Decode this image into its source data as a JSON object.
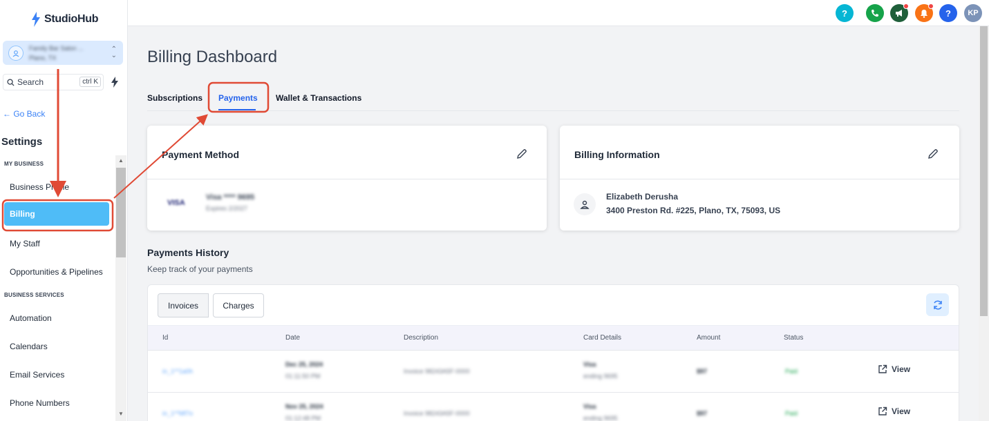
{
  "brand": {
    "name": "StudioHub"
  },
  "account": {
    "name": "Family Bar Salon ...",
    "sub": "Plano, TX"
  },
  "search": {
    "label": "Search",
    "shortcut": "ctrl K"
  },
  "sidebar": {
    "go_back": "← Go Back",
    "title": "Settings",
    "section_business": "MY BUSINESS",
    "section_services": "BUSINESS SERVICES",
    "items": [
      "Business Profile",
      "Billing",
      "My Staff",
      "Opportunities & Pipelines"
    ],
    "service_items": [
      "Automation",
      "Calendars",
      "Email Services",
      "Phone Numbers"
    ]
  },
  "header": {
    "icons": [
      {
        "name": "help-icon",
        "glyph": "?",
        "color": "#06b6d4"
      },
      {
        "name": "phone-icon",
        "glyph": "✆",
        "color": "#16a34a"
      },
      {
        "name": "megaphone-icon",
        "glyph": "📢",
        "color": "#166534"
      },
      {
        "name": "bell-icon",
        "glyph": "🔔",
        "color": "#f97316"
      },
      {
        "name": "help-circle-icon",
        "glyph": "?",
        "color": "#2563eb"
      }
    ],
    "avatar": "KP"
  },
  "page": {
    "title": "Billing Dashboard",
    "tabs": [
      "Subscriptions",
      "Payments",
      "Wallet & Transactions"
    ],
    "active_tab": "Payments"
  },
  "payment_method": {
    "title": "Payment Method",
    "brand": "VISA",
    "card": "Visa **** 9695",
    "expires": "Expires 2/2027"
  },
  "billing_info": {
    "title": "Billing Information",
    "name": "Elizabeth Derusha",
    "address": "3400 Preston Rd. #225, Plano, TX, 75093, US"
  },
  "history": {
    "title": "Payments History",
    "subtitle": "Keep track of your payments",
    "segments": [
      "Invoices",
      "Charges"
    ],
    "columns": [
      "Id",
      "Date",
      "Description",
      "Card Details",
      "Amount",
      "Status"
    ],
    "rows": [
      {
        "id": "in_1**1a0h",
        "date": "Dec 25, 2024",
        "time": "01:11:50 PM",
        "description": "Invoice 98243A5F-0000",
        "card": "Visa",
        "card_sub": "ending 9695",
        "amount": "$97",
        "status": "Paid",
        "action": "View"
      },
      {
        "id": "in_1**Mf7o",
        "date": "Nov 25, 2024",
        "time": "01:12:48 PM",
        "description": "Invoice 98243A5F-0000",
        "card": "Visa",
        "card_sub": "ending 9695",
        "amount": "$97",
        "status": "Paid",
        "action": "View"
      }
    ]
  },
  "colors": {
    "accent": "#2563eb",
    "active_nav": "#4fbcf7",
    "annotation": "#e04a35"
  }
}
